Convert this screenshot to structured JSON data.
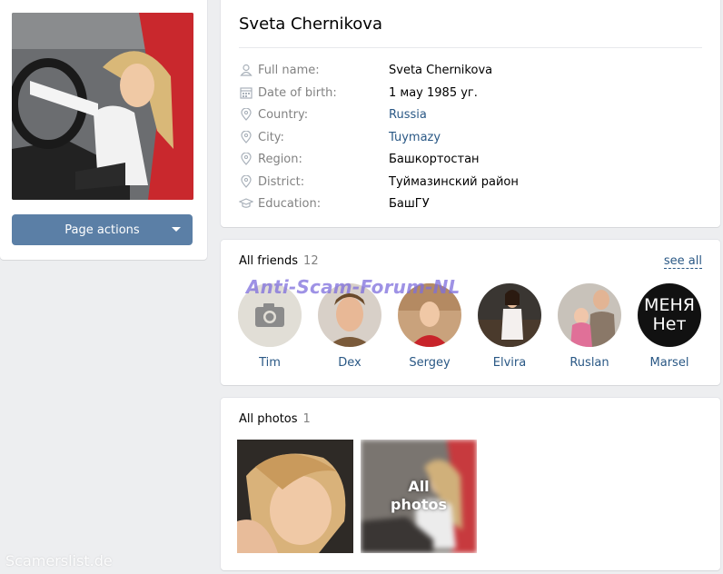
{
  "profile": {
    "name": "Sveta Chernikova",
    "page_actions_label": "Page actions"
  },
  "info": [
    {
      "icon": "person-icon",
      "label": "Full name:",
      "value": "Sveta Chernikova",
      "link": false
    },
    {
      "icon": "calendar-icon",
      "label": "Date of birth:",
      "value": "1 мау 1985 уг.",
      "link": false
    },
    {
      "icon": "location-icon",
      "label": "Country:",
      "value": "Russia",
      "link": true
    },
    {
      "icon": "location-icon",
      "label": "City:",
      "value": "Tuymazy",
      "link": true
    },
    {
      "icon": "location-icon",
      "label": "Region:",
      "value": "Башкортостан",
      "link": false
    },
    {
      "icon": "location-icon",
      "label": "District:",
      "value": "Туймазинский район",
      "link": false
    },
    {
      "icon": "graduation-cap-icon",
      "label": "Education:",
      "value": "БашГУ",
      "link": false
    }
  ],
  "friends": {
    "title": "All friends",
    "count": "12",
    "see_all": "see all",
    "items": [
      {
        "name": "Tim"
      },
      {
        "name": "Dex"
      },
      {
        "name": "Sergey"
      },
      {
        "name": "Elvira"
      },
      {
        "name": "Ruslan"
      },
      {
        "name": "Marsel",
        "avatar_text_1": "МЕНЯ",
        "avatar_text_2": "Нет"
      }
    ]
  },
  "photos": {
    "title": "All photos",
    "count": "1",
    "all_photos_line1": "All",
    "all_photos_line2": "photos"
  },
  "watermarks": {
    "forum": "Anti-Scam-Forum-NL",
    "site": "Scamerslist.de"
  },
  "colors": {
    "accent": "#5b7fa6",
    "link": "#2a5885",
    "background": "#edeef0",
    "label": "#828282"
  }
}
